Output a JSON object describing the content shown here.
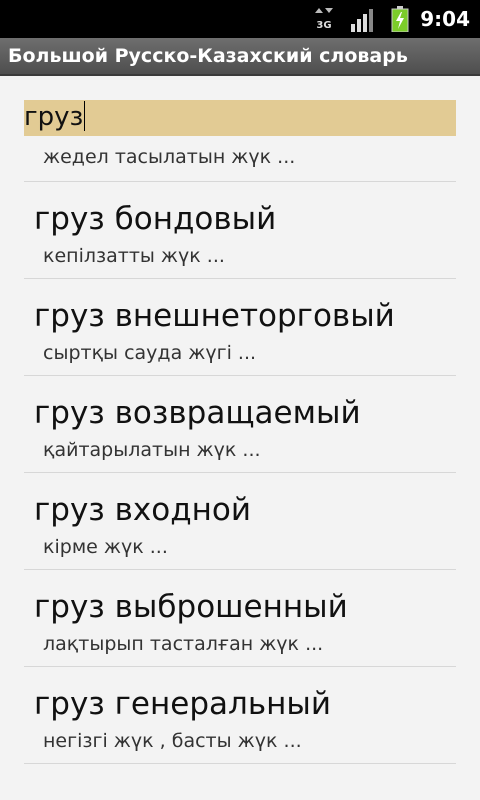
{
  "status_bar": {
    "network": "3G",
    "time": "9:04"
  },
  "app": {
    "title": "Большой Русско-Казахский словарь"
  },
  "search": {
    "value": "груз"
  },
  "results": {
    "partial": {
      "translation": "жедел тасылатын жүк ..."
    },
    "items": [
      {
        "term": "груз бондовый",
        "translation": "кепілзатты жүк ..."
      },
      {
        "term": "груз внешнеторговый",
        "translation": "сыртқы сауда жүгі ..."
      },
      {
        "term": "груз возвращаемый",
        "translation": "қайтарылатын жүк ..."
      },
      {
        "term": "груз входной",
        "translation": "кірме жүк ..."
      },
      {
        "term": "груз выброшенный",
        "translation": "лақтырып тасталған жүк ..."
      },
      {
        "term": "груз генеральный",
        "translation": "негізгі жүк , басты жүк ..."
      }
    ]
  },
  "colors": {
    "search_highlight": "#e2cb94",
    "list_background": "#f3f3f3",
    "status_bar": "#000000",
    "title_bar": "#5e5e5e"
  }
}
